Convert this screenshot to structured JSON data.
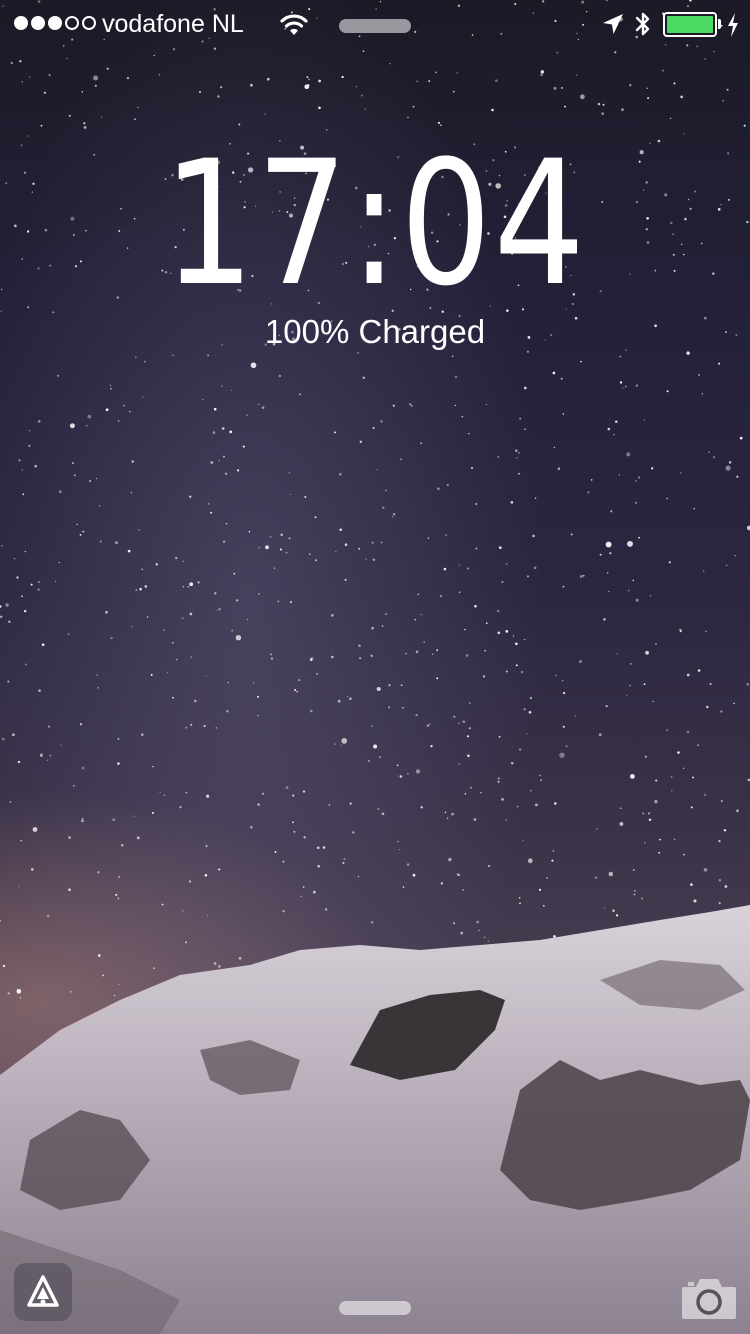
{
  "status_bar": {
    "signal_strength": {
      "filled": 3,
      "total": 5
    },
    "carrier": "vodafone NL",
    "wifi_icon": "wifi-icon",
    "location_icon": "location-arrow-icon",
    "bluetooth_icon": "bluetooth-icon",
    "battery_level": 1.0,
    "battery_color": "#4cd964",
    "charging_icon": "charging-bolt-icon"
  },
  "lock_screen": {
    "time": "17:04",
    "charge_status": "100% Charged"
  },
  "bottom_bar": {
    "notification_icon": "bell-icon",
    "camera_icon": "camera-icon"
  },
  "wallpaper": "night sky over snowy mountain"
}
